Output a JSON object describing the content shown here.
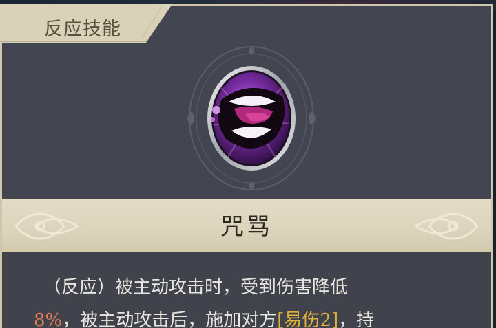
{
  "tab": {
    "label": "反应技能"
  },
  "skill": {
    "name": "咒骂",
    "icon": "cursing-mouth-icon",
    "description": {
      "line1": "（反应）被主动攻击时，受到伤害降低",
      "line2_value": "8%",
      "line2_mid": "，被主动攻击后，施加对方",
      "line2_effect": "[易伤2]",
      "line2_end": "，持"
    }
  },
  "colors": {
    "panel": "#434650",
    "banner": "#dcd4bc",
    "accent_orange": "#e07b52",
    "accent_yellow": "#e4b23a",
    "icon_purple": "#7b2ea6"
  }
}
